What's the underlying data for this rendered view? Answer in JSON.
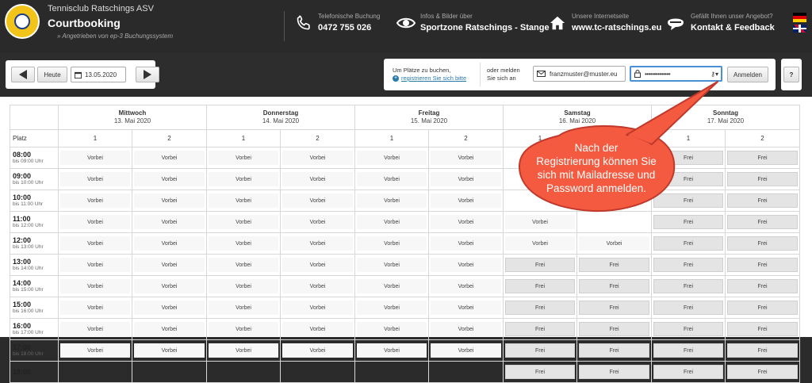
{
  "header": {
    "club_name": "Tennisclub Ratschings ASV",
    "app_title": "Courtbooking",
    "powered_by": "» Angetrieben von ep-3 Buchungssystem",
    "sections": [
      {
        "icon": "phone-icon",
        "small": "Telefonische Buchung",
        "big": "0472 755 026"
      },
      {
        "icon": "eye-icon",
        "small": "Infos & Bilder über",
        "big": "Sportzone Ratschings - Stange"
      },
      {
        "icon": "home-icon",
        "small": "Unsere Internetseite",
        "big": "www.tc-ratschings.eu"
      },
      {
        "icon": "speech-bubble-icon",
        "small": "Gefällt Ihnen unser Angebot?",
        "big": "Kontakt & Feedback"
      }
    ],
    "languages": [
      "de",
      "en"
    ]
  },
  "toolbar": {
    "prev_icon": "arrow-left-icon",
    "today_label": "Heute",
    "date_value": "13.05.2020",
    "next_icon": "arrow-right-icon"
  },
  "login": {
    "register_text": "Um Plätze zu buchen,",
    "register_link": "registrieren Sie sich bitte",
    "or_text_1": "oder melden",
    "or_text_2": "Sie sich an",
    "email_value": "franzmuster@muster.eu",
    "password_value": "••••••••••••••",
    "login_button": "Anmelden",
    "help_button": "?"
  },
  "grid": {
    "platz_label": "Platz",
    "days": [
      {
        "name": "Mittwoch",
        "date": "13. Mai 2020"
      },
      {
        "name": "Donnerstag",
        "date": "14. Mai 2020"
      },
      {
        "name": "Freitag",
        "date": "15. Mai 2020"
      },
      {
        "name": "Samstag",
        "date": "16. Mai 2020"
      },
      {
        "name": "Sonntag",
        "date": "17. Mai 2020"
      }
    ],
    "courts": [
      "1",
      "2"
    ],
    "times": [
      {
        "time": "08:00",
        "until": "bis 09:00 Uhr"
      },
      {
        "time": "09:00",
        "until": "bis 10:00 Uhr"
      },
      {
        "time": "10:00",
        "until": "bis 11:00 Uhr"
      },
      {
        "time": "11:00",
        "until": "bis 12:00 Uhr"
      },
      {
        "time": "12:00",
        "until": "bis 13:00 Uhr"
      },
      {
        "time": "13:00",
        "until": "bis 14:00 Uhr"
      },
      {
        "time": "14:00",
        "until": "bis 15:00 Uhr"
      },
      {
        "time": "15:00",
        "until": "bis 16:00 Uhr"
      },
      {
        "time": "16:00",
        "until": "bis 17:00 Uhr"
      },
      {
        "time": "17:00",
        "until": "bis 18:00 Uhr"
      },
      {
        "time": "18:00",
        "until": ""
      }
    ],
    "status_labels": {
      "past": "Vorbei",
      "free": "Frei"
    },
    "rows": [
      [
        "Vorbei",
        "Vorbei",
        "Vorbei",
        "Vorbei",
        "Vorbei",
        "Vorbei",
        "",
        "",
        "Frei",
        "Frei"
      ],
      [
        "Vorbei",
        "Vorbei",
        "Vorbei",
        "Vorbei",
        "Vorbei",
        "Vorbei",
        "",
        "",
        "Frei",
        "Frei"
      ],
      [
        "Vorbei",
        "Vorbei",
        "Vorbei",
        "Vorbei",
        "Vorbei",
        "Vorbei",
        "",
        "",
        "Frei",
        "Frei"
      ],
      [
        "Vorbei",
        "Vorbei",
        "Vorbei",
        "Vorbei",
        "Vorbei",
        "Vorbei",
        "Vorbei",
        "",
        "Frei",
        "Frei"
      ],
      [
        "Vorbei",
        "Vorbei",
        "Vorbei",
        "Vorbei",
        "Vorbei",
        "Vorbei",
        "Vorbei",
        "Vorbei",
        "Frei",
        "Frei"
      ],
      [
        "Vorbei",
        "Vorbei",
        "Vorbei",
        "Vorbei",
        "Vorbei",
        "Vorbei",
        "Frei",
        "Frei",
        "Frei",
        "Frei"
      ],
      [
        "Vorbei",
        "Vorbei",
        "Vorbei",
        "Vorbei",
        "Vorbei",
        "Vorbei",
        "Frei",
        "Frei",
        "Frei",
        "Frei"
      ],
      [
        "Vorbei",
        "Vorbei",
        "Vorbei",
        "Vorbei",
        "Vorbei",
        "Vorbei",
        "Frei",
        "Frei",
        "Frei",
        "Frei"
      ],
      [
        "Vorbei",
        "Vorbei",
        "Vorbei",
        "Vorbei",
        "Vorbei",
        "Vorbei",
        "Frei",
        "Frei",
        "Frei",
        "Frei"
      ],
      [
        "Vorbei",
        "Vorbei",
        "Vorbei",
        "Vorbei",
        "Vorbei",
        "Vorbei",
        "Frei",
        "Frei",
        "Frei",
        "Frei"
      ],
      [
        "",
        "",
        "",
        "",
        "",
        "",
        "Frei",
        "Frei",
        "Frei",
        "Frei"
      ]
    ]
  },
  "callout": {
    "lines": [
      "Nach der",
      "Registrierung können Sie",
      "sich mit Mailadresse und",
      "Password anmelden."
    ],
    "fill_color": "#f35a3f",
    "stroke_color": "#c0392b"
  }
}
